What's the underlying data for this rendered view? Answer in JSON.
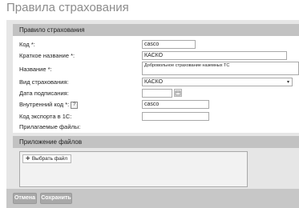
{
  "page": {
    "title": "Правила страхования"
  },
  "rule_section": {
    "header": "Правило страхования",
    "fields": {
      "code": {
        "label": "Код *:",
        "value": "casco"
      },
      "short_name": {
        "label": "Краткое название *:",
        "value": "КАСКО"
      },
      "name": {
        "label": "Название *:",
        "value": "Добровольное страхование наземных ТС"
      },
      "insurance_type": {
        "label": "Вид страхования:",
        "value": "КАСКО",
        "arrow": "▾"
      },
      "sign_date": {
        "label": "Дата подписания:",
        "value": ""
      },
      "internal_code": {
        "label": "Внутренний код *:",
        "value": "casco",
        "help": "?"
      },
      "export_code_1c": {
        "label": "Код экспорта в 1С:",
        "value": ""
      },
      "attached_files": {
        "label": "Прилагаемые файлы:"
      }
    }
  },
  "files_section": {
    "header": "Приложение файлов",
    "choose_button": "Выбрать файл",
    "plus_glyph": "✚"
  },
  "footer": {
    "cancel_label": "Отмена",
    "save_label": "Сохранить"
  },
  "colors": {
    "section_header": "#c2c2c2",
    "background": "#e6e6e6",
    "button": "#a8a8a8",
    "title": "#8c8c8c"
  }
}
